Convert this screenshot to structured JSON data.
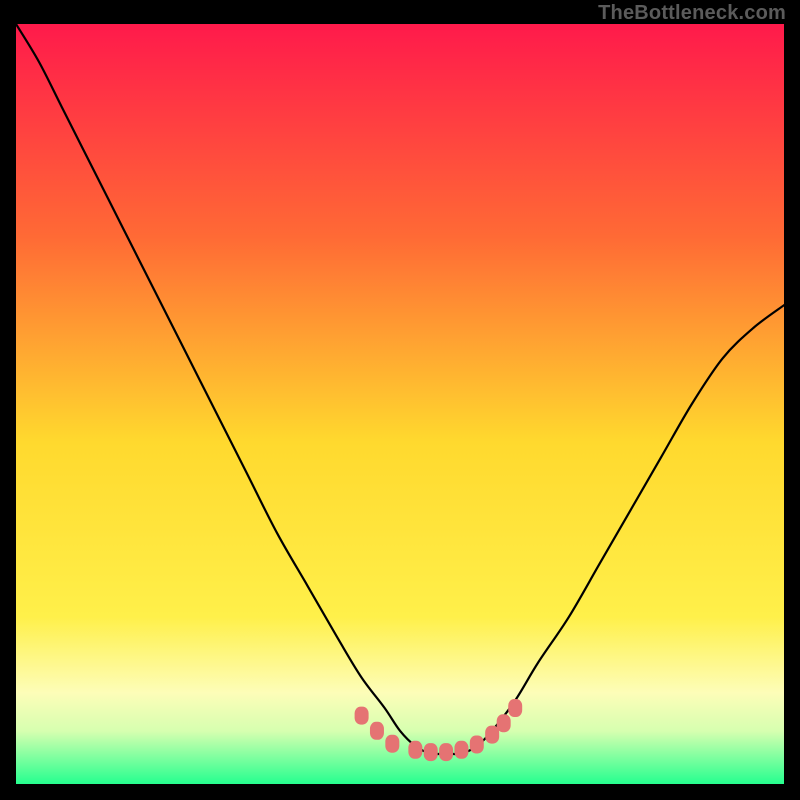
{
  "watermark": "TheBottleneck.com",
  "colors": {
    "gradient_top": "#ff1a4b",
    "gradient_mid_upper": "#ff7a2f",
    "gradient_mid": "#ffd92e",
    "gradient_lower": "#f8ff7a",
    "gradient_band_pale": "#fefecb",
    "gradient_bottom": "#26ff8f",
    "curve": "#000000",
    "marker": "#e57373",
    "frame": "#000000"
  },
  "chart_data": {
    "type": "line",
    "title": "",
    "xlabel": "",
    "ylabel": "",
    "xlim": [
      0,
      100
    ],
    "ylim": [
      0,
      100
    ],
    "grid": false,
    "series": [
      {
        "name": "bottleneck-curve",
        "x": [
          0,
          3,
          6,
          10,
          14,
          18,
          22,
          26,
          30,
          34,
          38,
          42,
          45,
          48,
          50,
          52,
          54,
          56,
          58,
          60,
          62,
          65,
          68,
          72,
          76,
          80,
          84,
          88,
          92,
          96,
          100
        ],
        "y": [
          100,
          95,
          89,
          81,
          73,
          65,
          57,
          49,
          41,
          33,
          26,
          19,
          14,
          10,
          7,
          5,
          4,
          4,
          4,
          5,
          7,
          11,
          16,
          22,
          29,
          36,
          43,
          50,
          56,
          60,
          63
        ]
      }
    ],
    "markers": [
      {
        "x": 45,
        "y": 9
      },
      {
        "x": 47,
        "y": 7
      },
      {
        "x": 49,
        "y": 5.3
      },
      {
        "x": 52,
        "y": 4.5
      },
      {
        "x": 54,
        "y": 4.2
      },
      {
        "x": 56,
        "y": 4.2
      },
      {
        "x": 58,
        "y": 4.5
      },
      {
        "x": 60,
        "y": 5.2
      },
      {
        "x": 62,
        "y": 6.5
      },
      {
        "x": 63.5,
        "y": 8
      },
      {
        "x": 65,
        "y": 10
      }
    ]
  }
}
